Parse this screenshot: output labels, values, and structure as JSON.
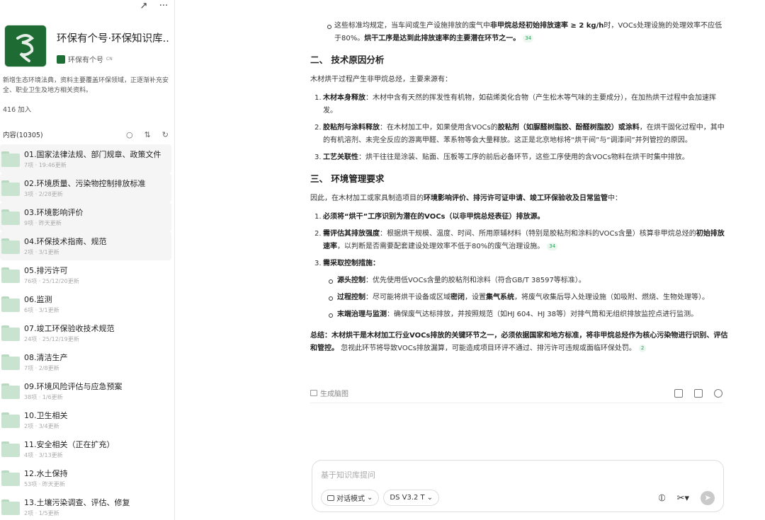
{
  "kb": {
    "title": "环保有个号·环保知识库...",
    "owner": "环保有个号",
    "owner_suffix": "CN",
    "desc": "新增生态环境法典，资料主要覆盖环保领域，正逐渐补充安全、职业卫生及地方相关资料。",
    "joined": "416 加入",
    "list_label": "内容(10305)"
  },
  "folders": [
    {
      "name": "01.国家法律法规、部门规章、政策文件",
      "meta": "7项 · 19:46更新"
    },
    {
      "name": "02.环境质量、污染物控制排放标准",
      "meta": "3项 · 2/28更新"
    },
    {
      "name": "03.环境影响评价",
      "meta": "9项 · 昨天更新"
    },
    {
      "name": "04.环保技术指南、规范",
      "meta": "2项 · 3/1更新"
    },
    {
      "name": "05.排污许可",
      "meta": "76项 · 25/12/20更新"
    },
    {
      "name": "06.监测",
      "meta": "6项 · 3/1更新"
    },
    {
      "name": "07.竣工环保验收技术规范",
      "meta": "24项 · 25/12/19更新"
    },
    {
      "name": "08.清洁生产",
      "meta": "7项 · 2/8更新"
    },
    {
      "name": "09.环境风险评估与应急预案",
      "meta": "38项 · 1/6更新"
    },
    {
      "name": "10.卫生相关",
      "meta": "2项 · 3/4更新"
    },
    {
      "name": "11.安全相关（正在扩充）",
      "meta": "4项 · 3/13更新"
    },
    {
      "name": "12.水土保持",
      "meta": "53项 · 昨天更新"
    },
    {
      "name": "13.土壤污染调查、评估、修复",
      "meta": "2项 · 1/5更新"
    }
  ],
  "reply": {
    "top_bullet_a": "这些标准均规定，当车间或生产设施排放的废气中",
    "top_bullet_b": "非甲烷总烃初始排放速率 ≥ 2 kg/h",
    "top_bullet_c": "时，VOCs处理设施的处理效率不应低于80%。",
    "top_bullet_d": "烘干工序是达到此排放速率的主要潜在环节之一。",
    "cite_34": "34",
    "cite_2": "2",
    "h2_tech": "二、 技术原因分析",
    "tech_intro": "木材烘干过程产生非甲烷总烃，主要来源有：",
    "t1_b": "木材本身释放",
    "t1": "：木材中含有天然的挥发性有机物，如萜烯类化合物（产生松木等气味的主要成分），在加热烘干过程中会加速挥发。",
    "t2_b": "胶粘剂与涂料释放",
    "t2_a": "：在木材加工中，如果使用含VOCs的",
    "t2_b2": "胶粘剂（如脲醛树脂胶、酚醛树脂胶）或涂料",
    "t2_c": "，在烘干固化过程中，其中的有机溶剂、未完全反应的游离甲醛、苯系物等会大量释放。这正是北京地标将“烘干间”与“调漆间”并列管控的原因。",
    "t3_b": "工艺关联性",
    "t3": "：烘干往往是涂装、贴面、压板等工序的前后必备环节，这些工序使用的含VOCs物料在烘干时集中排放。",
    "h2_env": "三、 环境管理要求",
    "env_intro_a": "因此，在木材加工或家具制造项目的",
    "env_intro_b": "环境影响评价、排污许可证申请、竣工环保验收及日常监管",
    "env_intro_c": "中：",
    "e1": "必须将“烘干”工序识别为潜在的VOCs（以非甲烷总烃表征）排放源。",
    "e2_b": "需评估其排放强度",
    "e2_a": "：根据烘干规模、温度、时间、所用原辅材料（特别是胶粘剂和涂料的VOCs含量）核算非甲烷总烃的",
    "e2_b2": "初始排放速率",
    "e2_c": "，以判断是否需要配套建设处理效率不低于80%的废气治理设施。",
    "e3": "需采取控制措施：",
    "s1_b": "源头控制",
    "s1": "：优先使用低VOCs含量的胶粘剂和涂料（符合GB/T 38597等标准）。",
    "s2_b": "过程控制",
    "s2_a": "：尽可能将烘干设备或区域",
    "s2_b2": "密闭",
    "s2_c": "，设置",
    "s2_b3": "集气系统",
    "s2_d": "，将废气收集后导入处理设施（如吸附、燃烧、生物处理等）。",
    "s3_b": "末端治理与监测",
    "s3": "：确保废气达标排放，并按照规范（如HJ 604、HJ 38等）对排气筒和无组织排放监控点进行监测。",
    "sum_b": "总结：木材烘干是木材加工行业VOCs排放的关键环节之一，必须依据国家和地方标准，将非甲烷总烃作为核心污染物进行识别、评估和管控。",
    "sum": "忽视此环节将导致VOCs排放漏算，可能造成项目环评不通过、排污许可违规或面临环保处罚。"
  },
  "footer": {
    "mindmap": "生成脑图"
  },
  "composer": {
    "placeholder": "基于知识库提问",
    "mode_label": "对话模式",
    "model_label": "DS V3.2 T"
  }
}
